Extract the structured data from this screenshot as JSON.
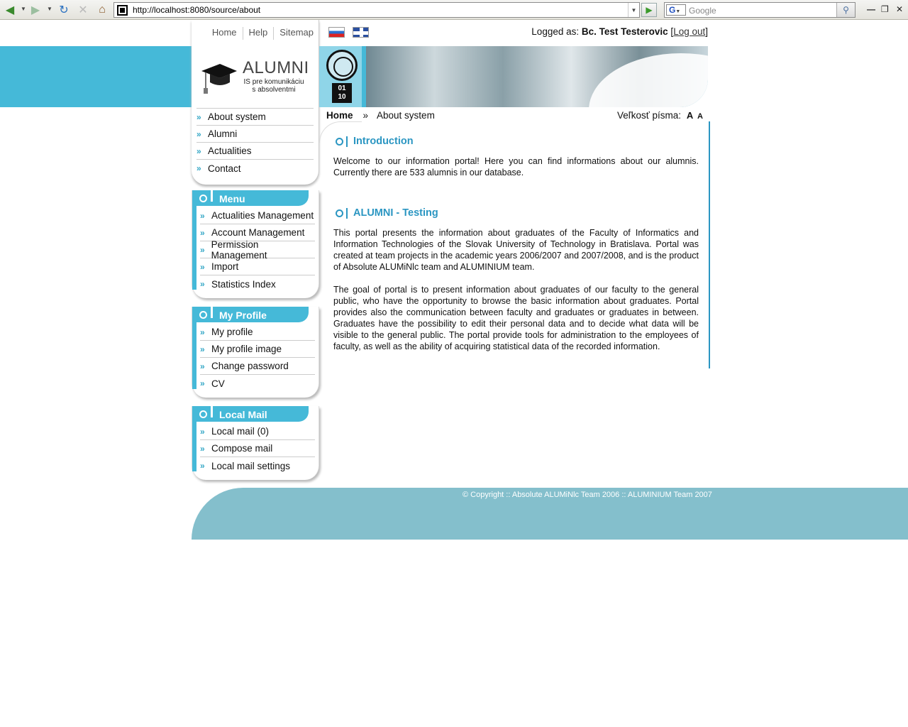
{
  "browser": {
    "url": "http://localhost:8080/source/about",
    "search_placeholder": "Google"
  },
  "topnav": [
    "Home",
    "Help",
    "Sitemap"
  ],
  "logo": {
    "title": "ALUMNI",
    "subtitle_line1": "IS pre komunikáciu",
    "subtitle_line2": "s absolventmi"
  },
  "user": {
    "logged_label": "Logged as:",
    "name": "Bc. Test Testerovic",
    "logout": "Log out"
  },
  "main_nav": [
    "About system",
    "Alumni",
    "Actualities",
    "Contact"
  ],
  "menu": {
    "title": "Menu",
    "items": [
      "Actualities Management",
      "Account Management",
      "Permission Management",
      "Import",
      "Statistics Index"
    ]
  },
  "profile": {
    "title": "My Profile",
    "items": [
      "My profile",
      "My profile image",
      "Change password",
      "CV"
    ]
  },
  "mail": {
    "title": "Local Mail",
    "items": [
      "Local mail (0)",
      "Compose mail",
      "Local mail settings"
    ]
  },
  "breadcrumb": {
    "home": "Home",
    "separator": "»",
    "current": "About system"
  },
  "font_size": {
    "label": "Veľkosť písma:",
    "big": "A",
    "small": "A"
  },
  "sections": {
    "intro_title": "Introduction",
    "intro_text": "Welcome to our information portal! Here you can find informations about our alumnis. Currently there are 533 alumnis in our database.",
    "testing_title": "ALUMNI - Testing",
    "testing_p1": "This portal presents the information about graduates of the Faculty of Informatics and Information Technologies of the Slovak University of Technology in Bratislava. Portal was created at team projects in the academic years 2006/2007 and 2007/2008, and is the product of Absolute ALUMiNlc team and ALUMINIUM team.",
    "testing_p2": "The goal of portal is to present information about graduates of our faculty to the general public, who have the opportunity to browse the basic information about graduates. Portal provides also the communication between faculty and graduates or graduates in between. Graduates have the possibility to edit their personal data and to decide what data will be visible to the general public. The portal provide tools for administration to the employees of faculty, as well as the ability of acquiring statistical data of the recorded information."
  },
  "footer": {
    "copyright": "© Copyright :: Absolute ALUMiNlc Team 2006 :: ALUMINIUM Team 2007"
  },
  "colors": {
    "accent": "#45b9d8",
    "heading": "#2b96c2",
    "footer": "#84bfcc"
  }
}
